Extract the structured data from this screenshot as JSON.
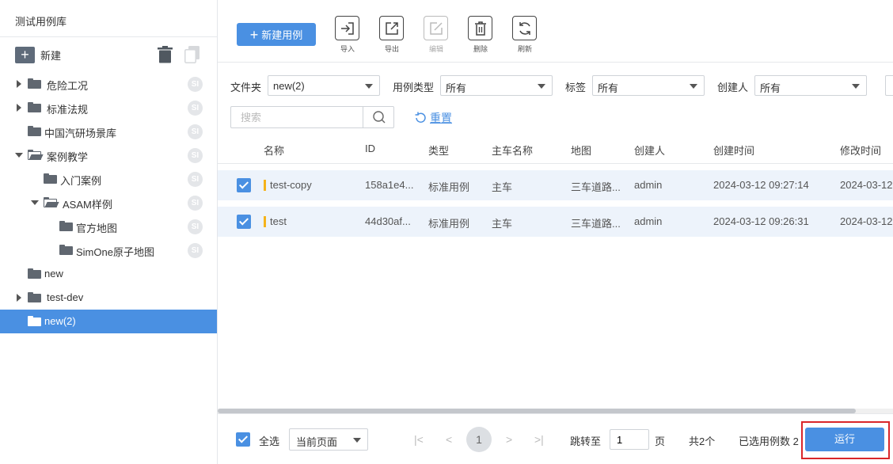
{
  "sidebar": {
    "title": "测试用例库",
    "new_label": "新建",
    "tree": [
      {
        "label": "危险工况",
        "badge": "SI"
      },
      {
        "label": "标准法规",
        "badge": "SI"
      },
      {
        "label": "中国汽研场景库",
        "badge": "SI"
      },
      {
        "label": "案例教学",
        "badge": "SI"
      },
      {
        "label": "入门案例",
        "badge": "SI"
      },
      {
        "label": "ASAM样例",
        "badge": "SI"
      },
      {
        "label": "官方地图",
        "badge": "SI"
      },
      {
        "label": "SimOne原子地图",
        "badge": "SI"
      },
      {
        "label": "new"
      },
      {
        "label": "test-dev"
      },
      {
        "label": "new(2)"
      }
    ]
  },
  "toolbar": {
    "new_case_label": "新建用例",
    "tools": [
      {
        "label": "导入",
        "icon": "import-icon"
      },
      {
        "label": "导出",
        "icon": "export-icon"
      },
      {
        "label": "编辑",
        "icon": "edit-icon"
      },
      {
        "label": "删除",
        "icon": "delete-icon"
      },
      {
        "label": "刷新",
        "icon": "refresh-icon"
      }
    ]
  },
  "filters": {
    "folder_label": "文件夹",
    "folder_value": "new(2)",
    "type_label": "用例类型",
    "type_value": "所有",
    "tag_label": "标签",
    "tag_value": "所有",
    "creator_label": "创建人",
    "creator_value": "所有",
    "search_placeholder": "搜索",
    "reset_label": "重置"
  },
  "table": {
    "columns": [
      "名称",
      "ID",
      "类型",
      "主车名称",
      "地图",
      "创建人",
      "创建时间",
      "修改时间"
    ],
    "rows": [
      {
        "name": "test-copy",
        "id": "158a1e4...",
        "type": "标准用例",
        "ego": "主车",
        "map": "三车道路...",
        "creator": "admin",
        "created": "2024-03-12 09:27:14",
        "modified": "2024-03-12",
        "checked": true
      },
      {
        "name": "test",
        "id": "44d30af...",
        "type": "标准用例",
        "ego": "主车",
        "map": "三车道路...",
        "creator": "admin",
        "created": "2024-03-12 09:26:31",
        "modified": "2024-03-12",
        "checked": true
      }
    ]
  },
  "footer": {
    "select_all_label": "全选",
    "page_scope_value": "当前页面",
    "first_icon": "|<",
    "prev_icon": "<",
    "current_page": "1",
    "next_icon": ">",
    "last_icon": ">|",
    "goto_label": "跳转至",
    "goto_value": "1",
    "page_unit": "页",
    "total_label": "共2个",
    "selected_label": "已选用例数 2",
    "run_label": "运行"
  },
  "colors": {
    "accent": "#4a90e2",
    "selected_row_bg": "#edf3fb",
    "highlight_border": "#d9262a",
    "name_marker": "#f5b31b"
  }
}
